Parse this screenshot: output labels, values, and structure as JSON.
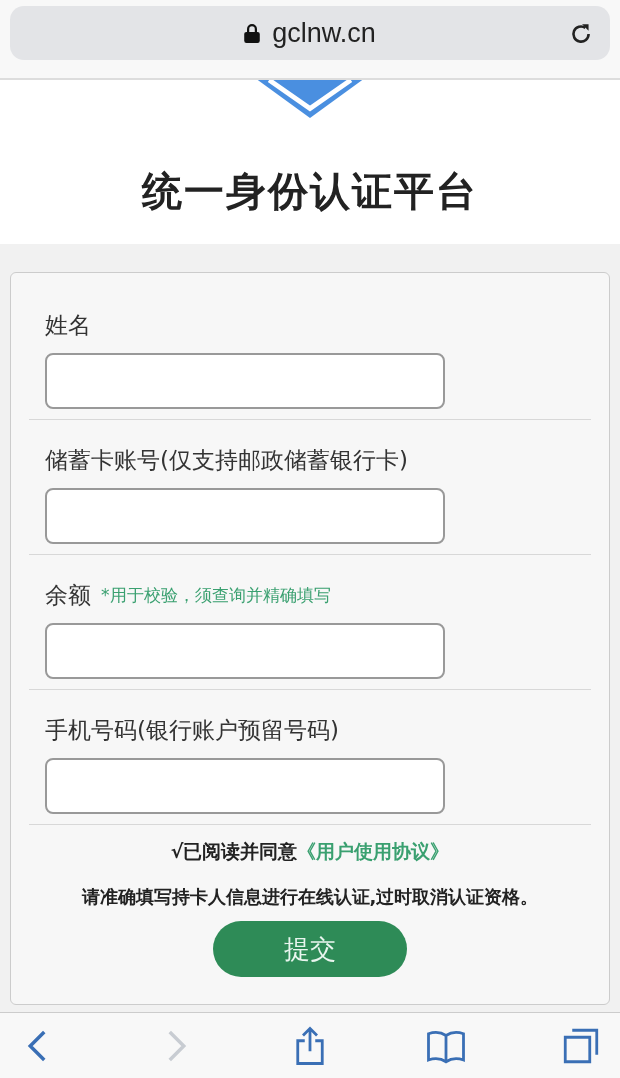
{
  "browser": {
    "url": "gclnw.cn",
    "secure": true
  },
  "header": {
    "title": "统一身份认证平台"
  },
  "fields": [
    {
      "label": "姓名"
    },
    {
      "label": "储蓄卡账号(仅支持邮政储蓄银行卡)"
    },
    {
      "label": "余额",
      "hint": "*用于校验，须查询并精确填写"
    },
    {
      "label": "手机号码(银行账户预留号码)"
    }
  ],
  "agreement": {
    "mark": "√",
    "text": "已阅读并同意",
    "link": "《用户使用协议》"
  },
  "notice": "请准确填写持卡人信息进行在线认证,过时取消认证资格。",
  "submit": "提交",
  "toolbar": [
    {
      "kind": "back",
      "disabled": false
    },
    {
      "kind": "forward",
      "disabled": true
    },
    {
      "kind": "share",
      "disabled": false
    },
    {
      "kind": "bookmarks",
      "disabled": false
    },
    {
      "kind": "tabs",
      "disabled": false
    }
  ]
}
